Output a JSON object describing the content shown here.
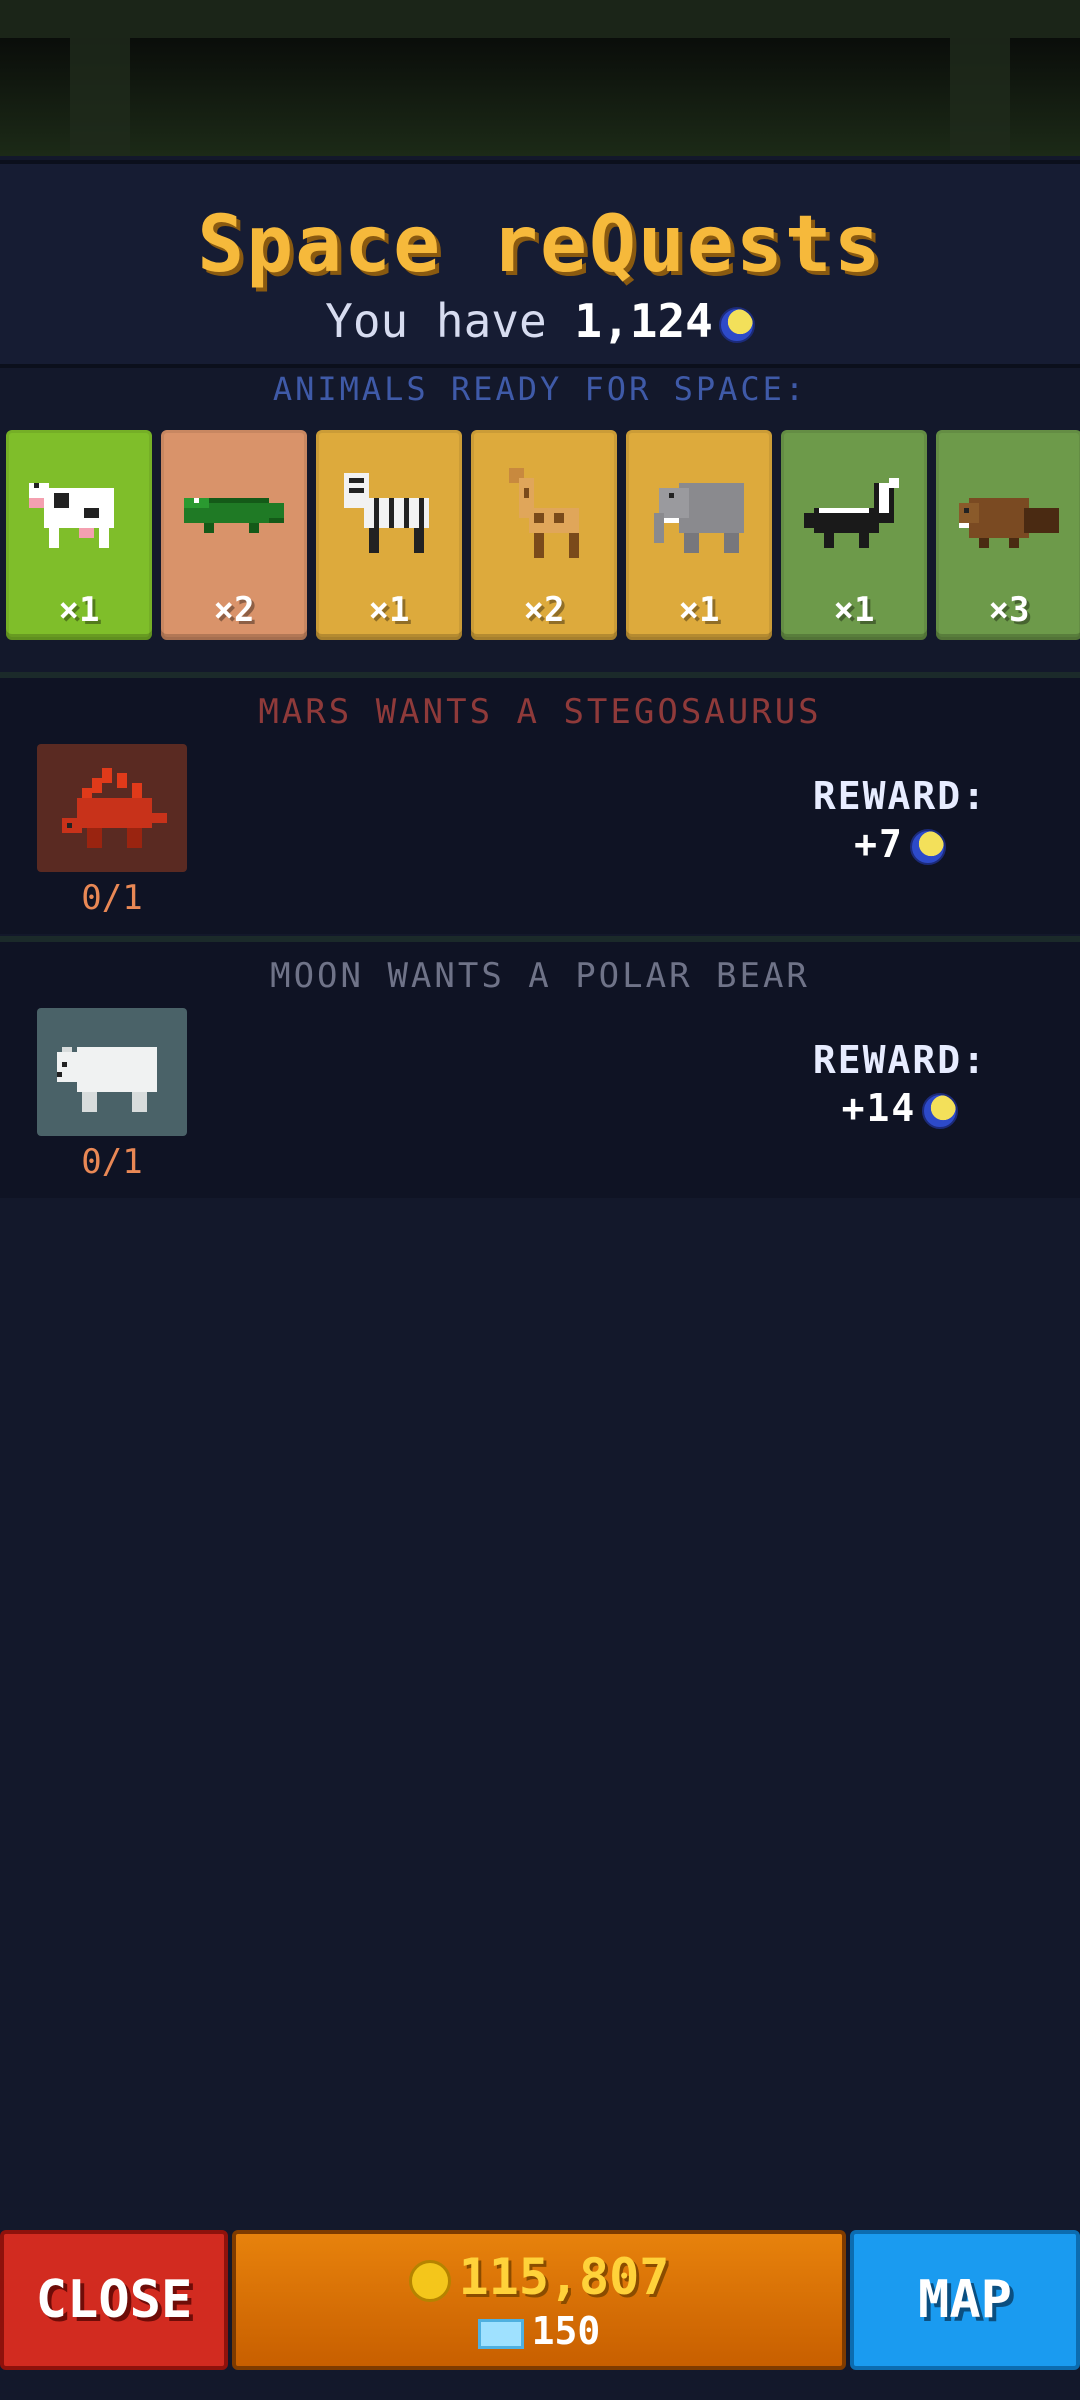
{
  "header": {
    "title": "Space reQuests",
    "balance_prefix": "You have",
    "balance_amount": "1,124",
    "balance_icon": "moon-coin-icon"
  },
  "ready": {
    "label": "ANIMALS READY FOR SPACE:",
    "animals": [
      {
        "animal": "cow",
        "count": "×1",
        "bg": "#7fbe2a"
      },
      {
        "animal": "crocodile",
        "count": "×2",
        "bg": "#d9936a"
      },
      {
        "animal": "zebra",
        "count": "×1",
        "bg": "#ddaa3c"
      },
      {
        "animal": "giraffe",
        "count": "×2",
        "bg": "#ddaa3c"
      },
      {
        "animal": "elephant",
        "count": "×1",
        "bg": "#ddaa3c"
      },
      {
        "animal": "skunk",
        "count": "×1",
        "bg": "#6d9a4a"
      },
      {
        "animal": "beaver",
        "count": "×3",
        "bg": "#6d9a4a"
      }
    ]
  },
  "requests": [
    {
      "title": "MARS WANTS A STEGOSAURUS",
      "title_color": "#8f3a3a",
      "icon": "stegosaurus-icon",
      "icon_bg": "#5a2a22",
      "progress": "0/1",
      "reward_label": "REWARD:",
      "reward_value": "+7"
    },
    {
      "title": "MOON WANTS A POLAR BEAR",
      "title_color": "#6f7388",
      "icon": "polar-bear-icon",
      "icon_bg": "#4a6268",
      "progress": "0/1",
      "reward_label": "REWARD:",
      "reward_value": "+14"
    }
  ],
  "footer": {
    "close_label": "CLOSE",
    "coins": "115,807",
    "gems": "150",
    "map_label": "MAP"
  }
}
